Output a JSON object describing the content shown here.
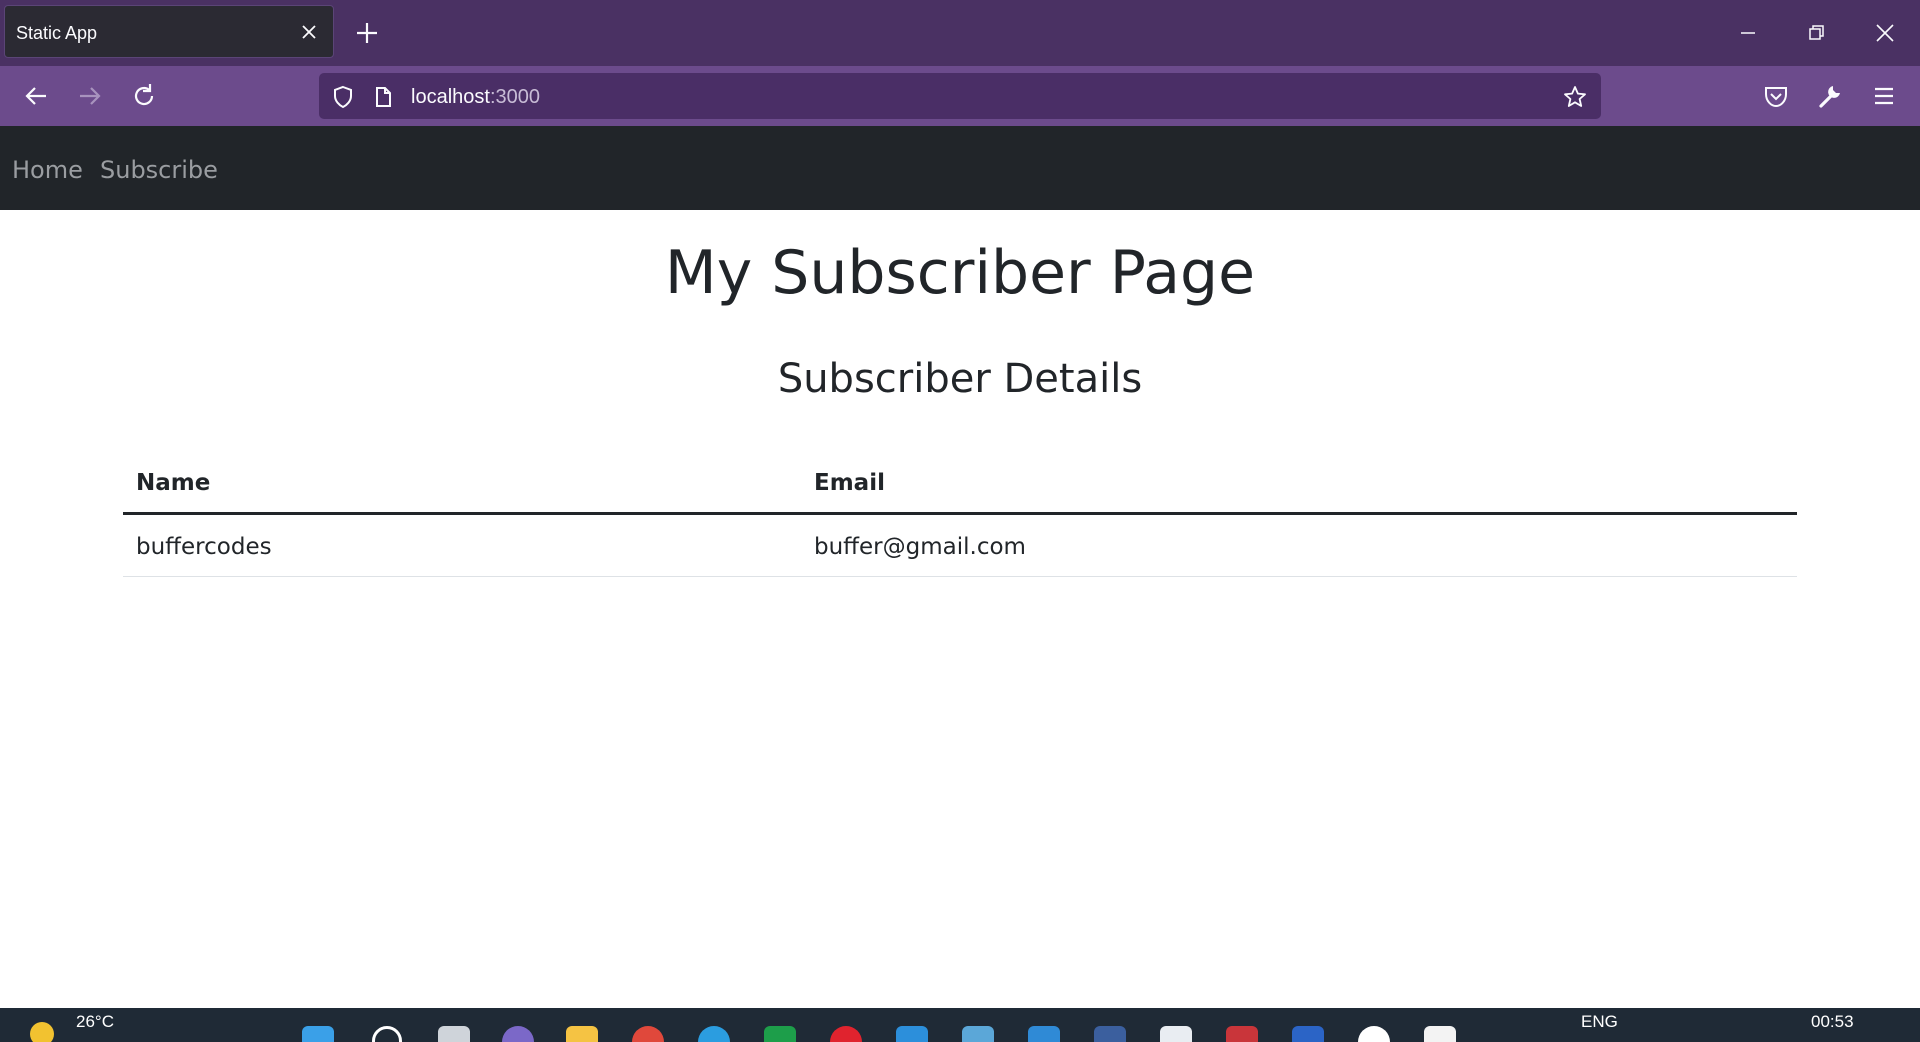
{
  "browser": {
    "tab_title": "Static App",
    "url_host": "localhost",
    "url_port": ":3000"
  },
  "site_nav": {
    "items": [
      {
        "label": "Home"
      },
      {
        "label": "Subscribe"
      }
    ]
  },
  "page": {
    "title": "My Subscriber Page",
    "subtitle": "Subscriber Details",
    "table": {
      "headers": [
        "Name",
        "Email"
      ],
      "rows": [
        {
          "name": "buffercodes",
          "email": "buffer@gmail.com"
        }
      ]
    }
  },
  "taskbar": {
    "weather": "26°C",
    "language": "ENG",
    "time": "00:53"
  },
  "colors": {
    "tabstrip": "#4a3163",
    "toolbar": "#6c4b8c",
    "site_nav": "#212529",
    "text": "#212529"
  }
}
